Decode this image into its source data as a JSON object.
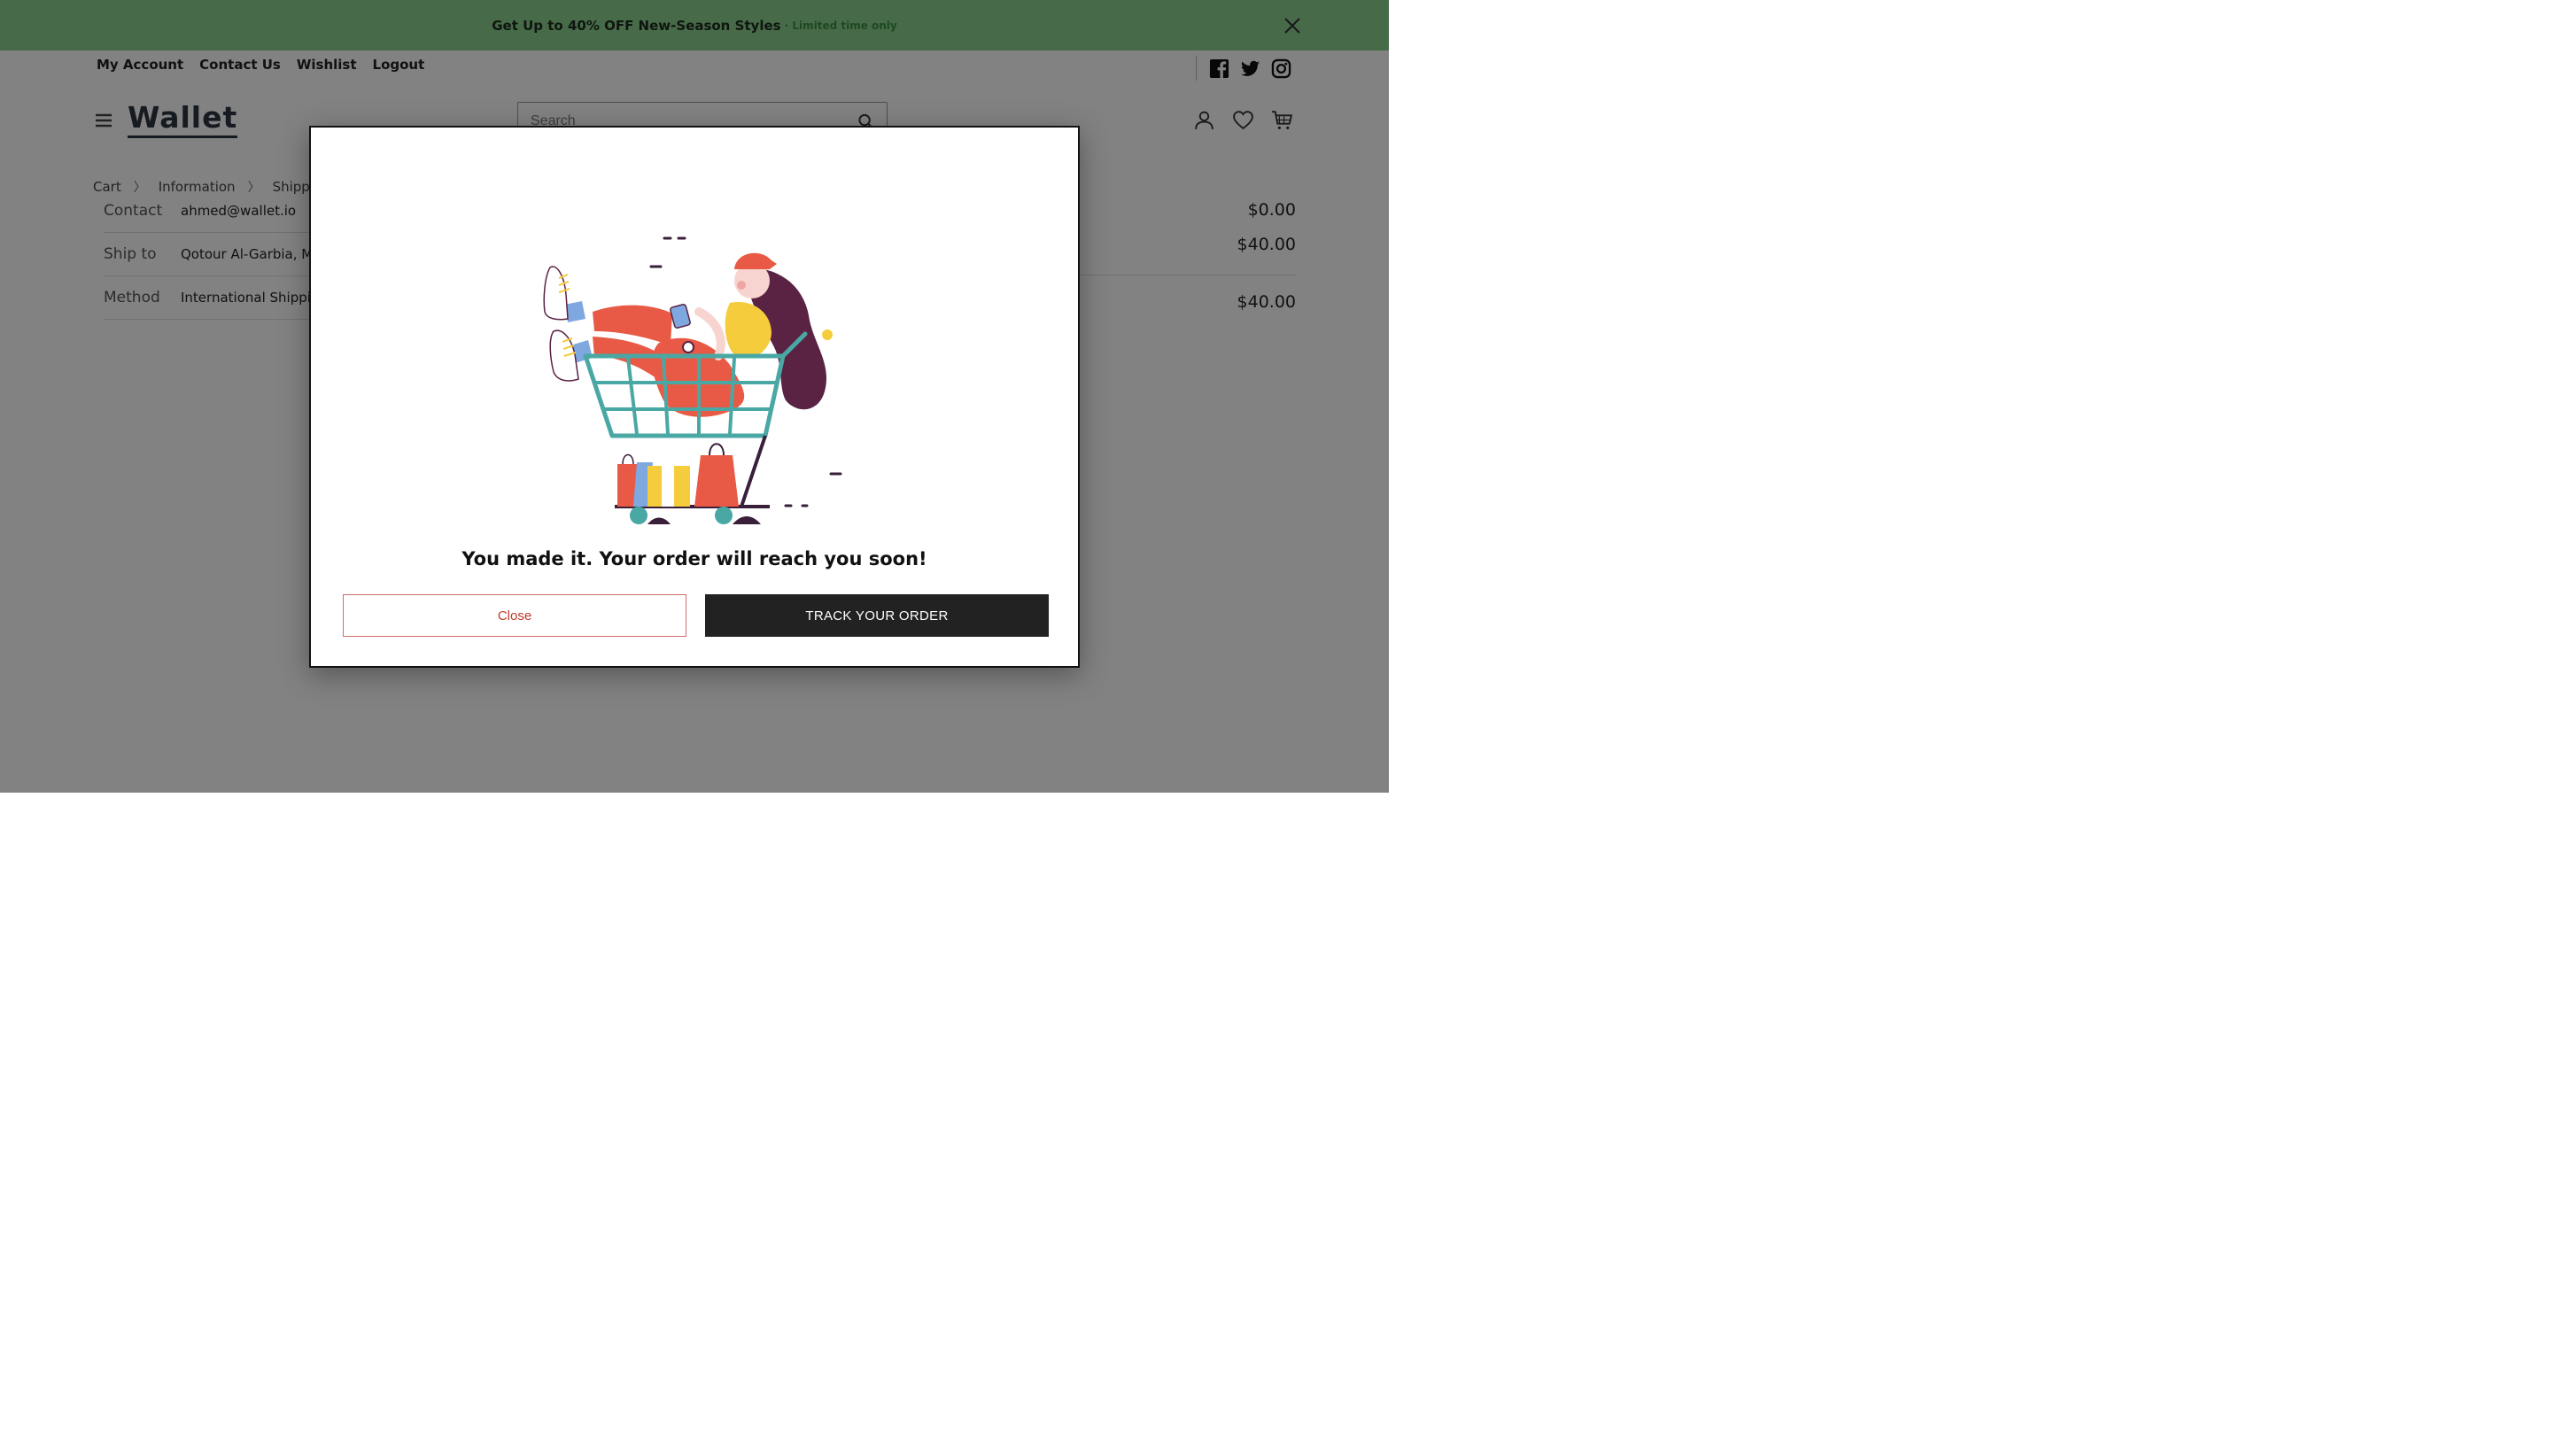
{
  "promo": {
    "text": "Get Up to 40% OFF New-Season Styles",
    "sub": "· Limited time only",
    "bg_color": "#8bd28d",
    "close_icon": "close-icon"
  },
  "topnav": {
    "items": [
      "My Account",
      "Contact Us",
      "Wishlist",
      "Logout"
    ]
  },
  "social": {
    "icons": [
      "facebook-icon",
      "twitter-icon",
      "instagram-icon"
    ]
  },
  "header": {
    "logo": "Wallet",
    "search_placeholder": "Search",
    "icons": [
      "menu-icon",
      "user-icon",
      "heart-icon",
      "cart-icon"
    ]
  },
  "breadcrumb": {
    "items": [
      "Cart",
      "Information",
      "Shipping"
    ]
  },
  "info": {
    "rows": [
      {
        "label": "Contact",
        "value": "ahmed@wallet.io"
      },
      {
        "label": "Ship to",
        "value": "Qotour Al-Garbia, My"
      },
      {
        "label": "Method",
        "value": "International Shippin"
      }
    ]
  },
  "summary": {
    "prices": [
      "$0.00",
      "$40.00",
      "$40.00"
    ]
  },
  "modal": {
    "message": "You made it. Your order will reach you soon!",
    "close_label": "Close",
    "track_label": "TRACK YOUR ORDER",
    "illustration": "shopping-cart-illustration"
  }
}
